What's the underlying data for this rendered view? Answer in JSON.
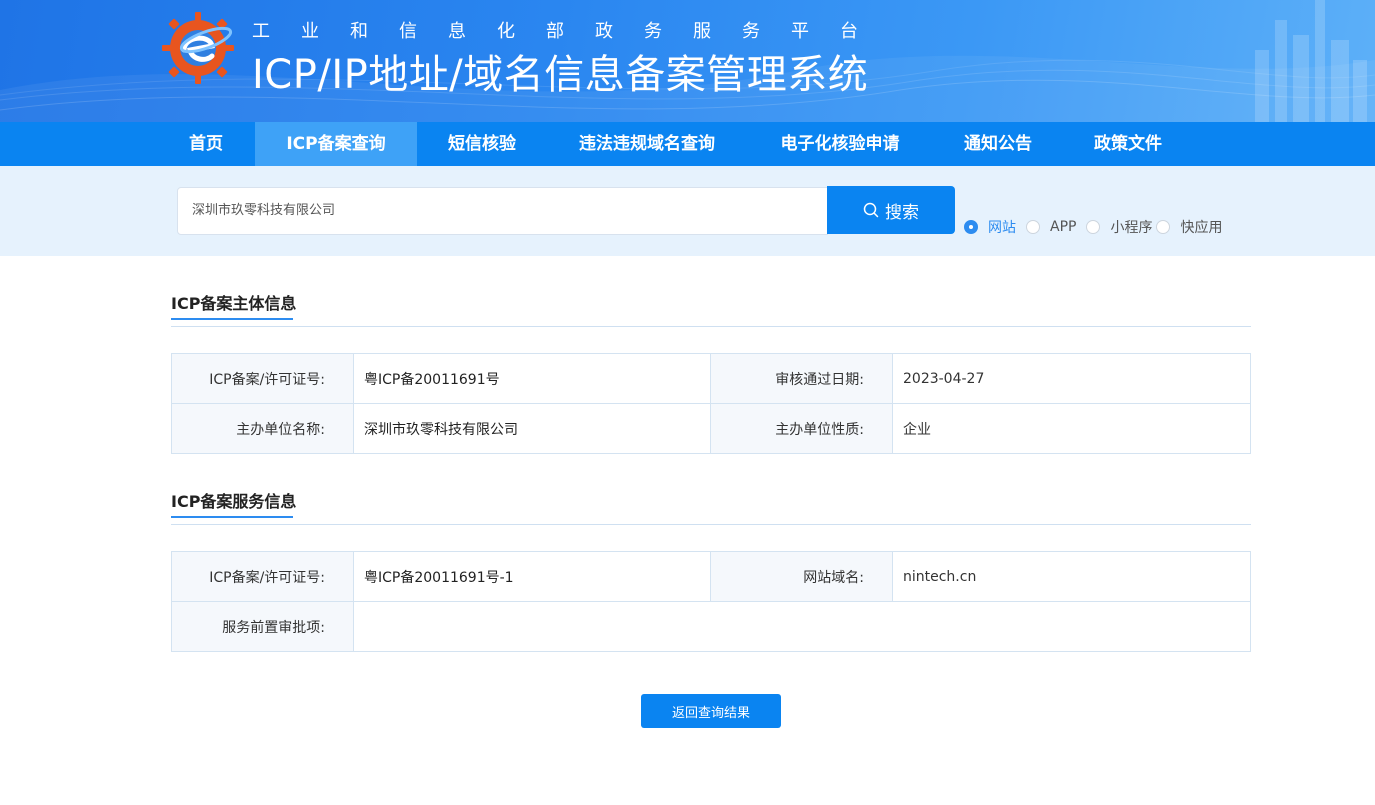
{
  "header": {
    "subtitle": "工业和信息化部政务服务平台",
    "title": "ICP/IP地址/域名信息备案管理系统"
  },
  "nav": {
    "items": [
      {
        "label": "首页"
      },
      {
        "label": "ICP备案查询"
      },
      {
        "label": "短信核验"
      },
      {
        "label": "违法违规域名查询"
      },
      {
        "label": "电子化核验申请"
      },
      {
        "label": "通知公告"
      },
      {
        "label": "政策文件"
      }
    ],
    "active": "ICP备案查询"
  },
  "search": {
    "value": "深圳市玖零科技有限公司",
    "button_label": "搜索",
    "options": [
      {
        "label": "网站",
        "checked": true
      },
      {
        "label": "APP",
        "checked": false
      },
      {
        "label": "小程序",
        "checked": false
      },
      {
        "label": "快应用",
        "checked": false
      }
    ]
  },
  "subject_info": {
    "title": "ICP备案主体信息",
    "rows": [
      {
        "label1": "ICP备案/许可证号:",
        "value1": "粤ICP备20011691号",
        "label2": "审核通过日期:",
        "value2": "2023-04-27"
      },
      {
        "label1": "主办单位名称:",
        "value1": "深圳市玖零科技有限公司",
        "label2": "主办单位性质:",
        "value2": "企业"
      }
    ]
  },
  "service_info": {
    "title": "ICP备案服务信息",
    "rows": [
      {
        "label1": "ICP备案/许可证号:",
        "value1": "粤ICP备20011691号-1",
        "label2": "网站域名:",
        "value2": "nintech.cn"
      },
      {
        "label1": "服务前置审批项:",
        "value1": ""
      }
    ]
  },
  "actions": {
    "back_label": "返回查询结果"
  },
  "colors": {
    "primary": "#0a84f1",
    "nav_active": "#3ea2f7",
    "search_band": "#e6f2fd"
  }
}
